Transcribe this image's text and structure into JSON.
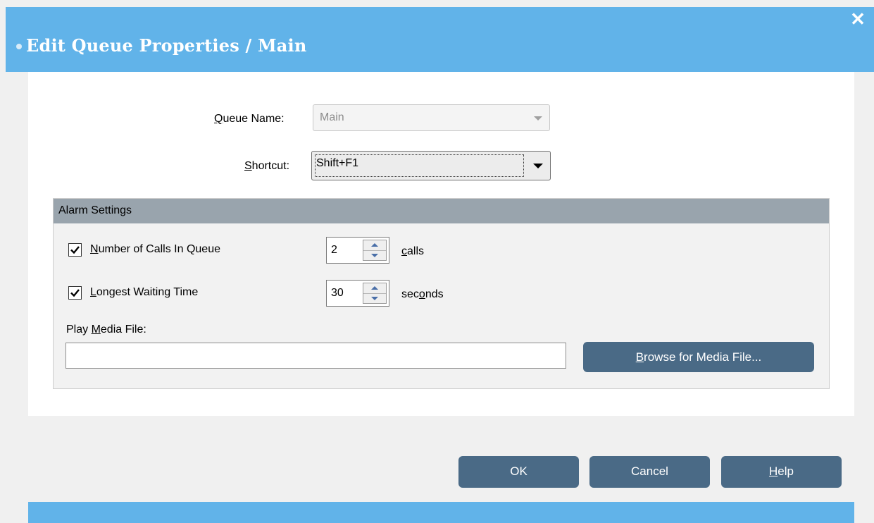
{
  "window": {
    "title": "Edit Queue Properties / Main",
    "close_label": "✕"
  },
  "queue_name": {
    "label_accel": "Q",
    "label_rest": "ueue Name:",
    "value": "Main"
  },
  "shortcut": {
    "label_accel": "S",
    "label_rest": "hortcut:",
    "value": "Shift+F1"
  },
  "alarm": {
    "header": "Alarm Settings",
    "calls": {
      "accel": "N",
      "rest": "umber of Calls In Queue",
      "checked": true,
      "value": "2",
      "unit_accel": "c",
      "unit_rest": "alls"
    },
    "waiting": {
      "accel": "L",
      "rest": "ongest Waiting Time",
      "checked": true,
      "value": "30",
      "unit_pre": "sec",
      "unit_accel": "o",
      "unit_post": "nds"
    },
    "media": {
      "label_pre": "Play ",
      "label_accel": "M",
      "label_post": "edia File:",
      "value": "",
      "browse_accel": "B",
      "browse_rest": "rowse for Media File..."
    }
  },
  "buttons": {
    "ok": "OK",
    "cancel": "Cancel",
    "help_accel": "H",
    "help_rest": "elp"
  },
  "colors": {
    "title_bar": "#61b3e9",
    "button": "#4a6a86",
    "group_header": "#99a4ad"
  }
}
